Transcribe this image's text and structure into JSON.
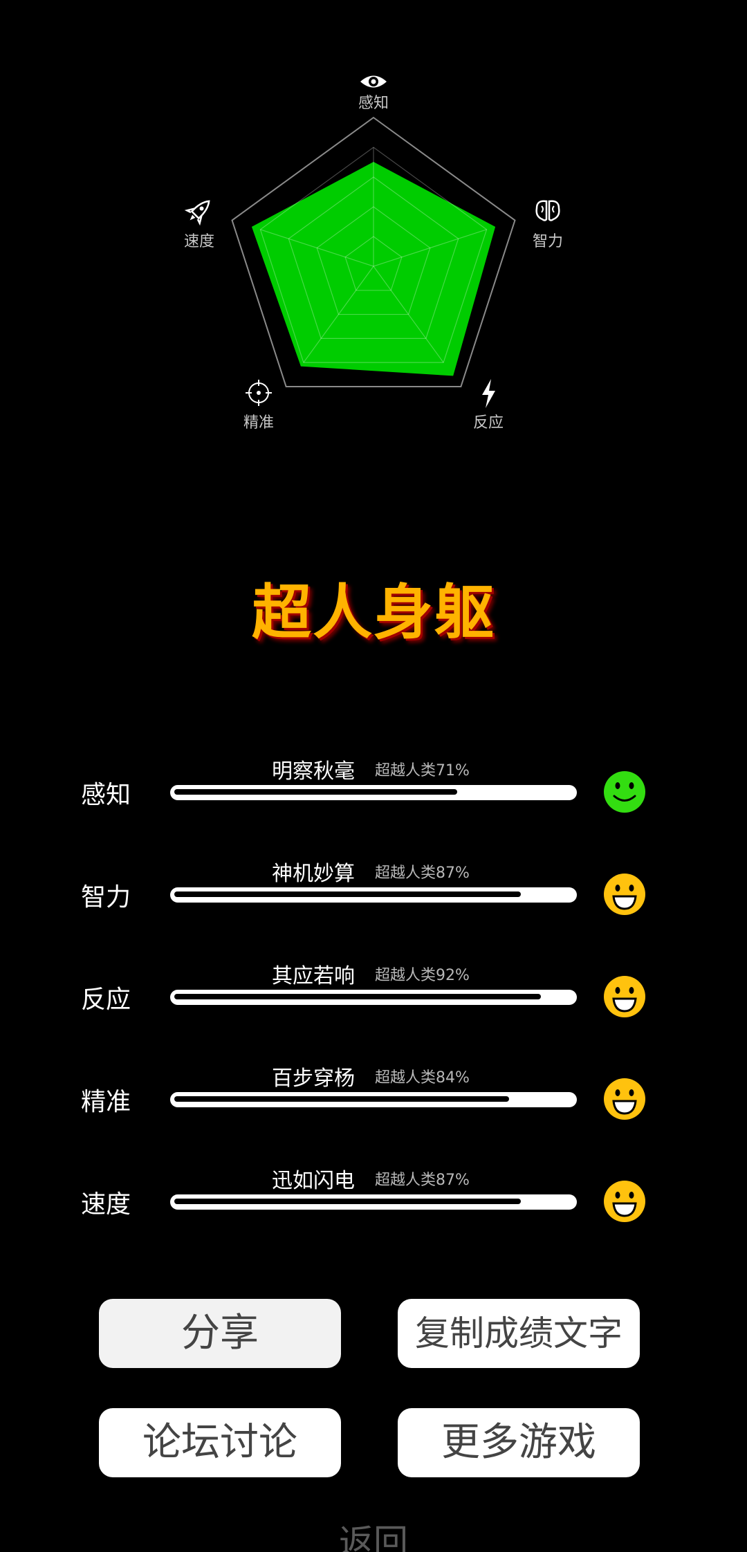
{
  "radar": {
    "axes": [
      {
        "label": "感知",
        "icon": "eye-icon",
        "value": 0.71
      },
      {
        "label": "智力",
        "icon": "brain-icon",
        "value": 0.87
      },
      {
        "label": "反应",
        "icon": "lightning-icon",
        "value": 0.92
      },
      {
        "label": "精准",
        "icon": "target-icon",
        "value": 0.84
      },
      {
        "label": "速度",
        "icon": "rocket-icon",
        "value": 0.87
      }
    ],
    "fill_color": "#00cc00",
    "grid_color": "#8a8a8a"
  },
  "result_title": "超人身躯",
  "stats": [
    {
      "name": "感知",
      "desc": "明察秋毫",
      "pct_text": "超越人类71%",
      "value": 0.71,
      "face": "smile",
      "face_color": "#33dd11"
    },
    {
      "name": "智力",
      "desc": "神机妙算",
      "pct_text": "超越人类87%",
      "value": 0.87,
      "face": "grin",
      "face_color": "#ffc20e"
    },
    {
      "name": "反应",
      "desc": "其应若响",
      "pct_text": "超越人类92%",
      "value": 0.92,
      "face": "grin",
      "face_color": "#ffc20e"
    },
    {
      "name": "精准",
      "desc": "百步穿杨",
      "pct_text": "超越人类84%",
      "value": 0.84,
      "face": "grin",
      "face_color": "#ffc20e"
    },
    {
      "name": "速度",
      "desc": "迅如闪电",
      "pct_text": "超越人类87%",
      "value": 0.87,
      "face": "grin",
      "face_color": "#ffc20e"
    }
  ],
  "buttons": {
    "share": "分享",
    "copy": "复制成绩文字",
    "forum": "论坛讨论",
    "more_games": "更多游戏"
  },
  "back": "返回"
}
